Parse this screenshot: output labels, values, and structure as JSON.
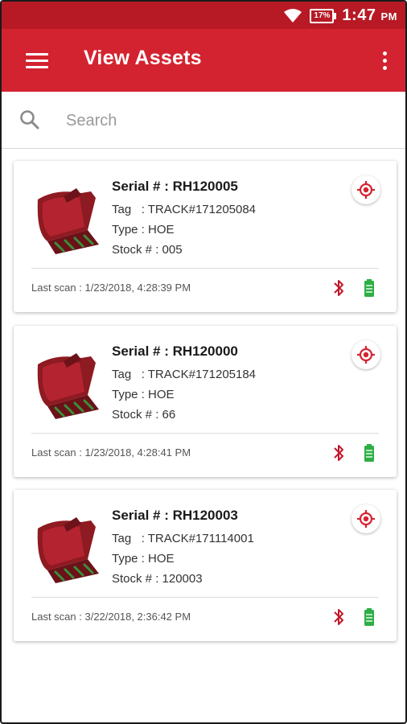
{
  "status": {
    "battery": "17%",
    "time": "1:47",
    "ampm": "PM"
  },
  "appbar": {
    "title": "View Assets"
  },
  "search": {
    "placeholder": "Search"
  },
  "assets": [
    {
      "serial": "Serial # : RH120005",
      "tag_label": "Tag",
      "tag": ": TRACK#171205084",
      "type": "Type : HOE",
      "stock": "Stock # : 005",
      "last_scan": "Last scan : 1/23/2018, 4:28:39 PM"
    },
    {
      "serial": "Serial # : RH120000",
      "tag_label": "Tag",
      "tag": ": TRACK#171205184",
      "type": "Type : HOE",
      "stock": "Stock # : 66",
      "last_scan": "Last scan : 1/23/2018, 4:28:41 PM"
    },
    {
      "serial": "Serial # : RH120003",
      "tag_label": "Tag",
      "tag": ": TRACK#171114001",
      "type": "Type : HOE",
      "stock": "Stock # : 120003",
      "last_scan": "Last scan : 3/22/2018, 2:36:42 PM"
    }
  ],
  "colors": {
    "primary": "#d32330",
    "status_bar": "#b71a25",
    "accent_red": "#c2182b",
    "battery_green": "#2eae45"
  },
  "icons": {
    "menu": "hamburger-icon",
    "more": "more-vert-icon",
    "search": "search-icon",
    "locate": "gps-target-icon",
    "bluetooth": "bluetooth-icon",
    "battery": "battery-full-icon",
    "asset": "excavator-bucket-icon"
  }
}
